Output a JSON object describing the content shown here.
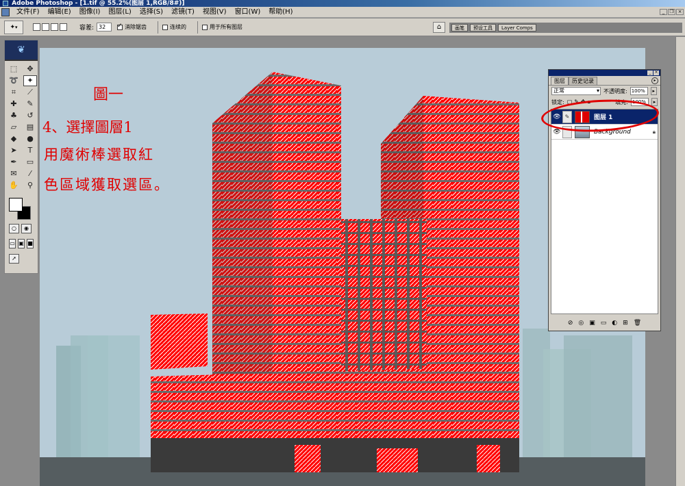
{
  "window": {
    "title": "Adobe Photoshop - [1.tif @ 55.2%(图层 1,RGB/8#)]"
  },
  "menu": [
    "文件(F)",
    "编辑(E)",
    "图像(I)",
    "图层(L)",
    "选择(S)",
    "滤镜(T)",
    "视图(V)",
    "窗口(W)",
    "帮助(H)"
  ],
  "options": {
    "tolerance_label": "容差:",
    "tolerance_value": "32",
    "antialias_label": "消除锯齿",
    "contiguous_label": "连续的",
    "all_layers_label": "用于所有图层"
  },
  "palette_well": {
    "tabs": [
      "画笔",
      "预设工具",
      "Layer Comps"
    ]
  },
  "annotation": {
    "title": "圖一",
    "line1": "4、選擇圖層1",
    "line2": "用魔術棒選取紅",
    "line3": "色區域獲取選區。"
  },
  "layers_panel": {
    "tabs": [
      "图层",
      "历史记录"
    ],
    "blend_mode": "正常",
    "opacity_label": "不透明度:",
    "opacity_value": "100%",
    "lock_label": "锁定:",
    "fill_label": "填充:",
    "fill_value": "100%",
    "layers": [
      {
        "name": "图层 1",
        "selected": true
      },
      {
        "name": "Background",
        "selected": false
      }
    ]
  },
  "colors": {
    "selection_red": "#ff0000",
    "accent": "#0a246a",
    "annotation": "#e00000"
  }
}
